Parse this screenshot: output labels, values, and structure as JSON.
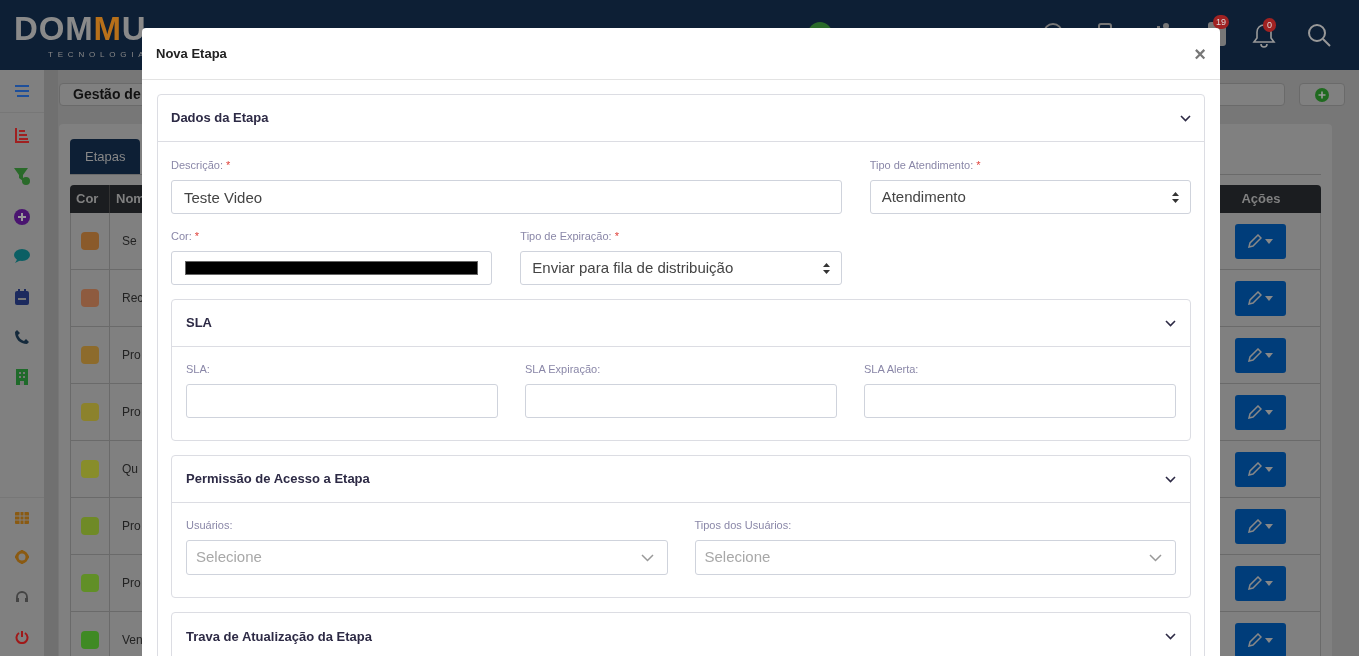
{
  "logo": {
    "prefix": "DOM",
    "accent": "M",
    "suffix": "U",
    "tagline": "TECNOLOGIA"
  },
  "header": {
    "badges": [
      {
        "count": "19"
      },
      {
        "count": "0"
      }
    ]
  },
  "page_title": "Gestão de",
  "tabs": [
    {
      "label": "Etapas",
      "selected": true
    }
  ],
  "table": {
    "columns": [
      "Cor",
      "Nom",
      "Ações"
    ],
    "rows": [
      {
        "color": "#8a5a2a",
        "name": "Se"
      },
      {
        "color": "#8e5b3f",
        "name": "Rec"
      },
      {
        "color": "#8d6b2c",
        "name": "Pro"
      },
      {
        "color": "#8c822c",
        "name": "Pro"
      },
      {
        "color": "#888d2a",
        "name": "Qu"
      },
      {
        "color": "#6f8a27",
        "name": "Pro"
      },
      {
        "color": "#618f27",
        "name": "Pro"
      },
      {
        "color": "#3f8a24",
        "name": "Ven"
      }
    ]
  },
  "modal": {
    "title": "Nova Etapa",
    "close": "×",
    "section": {
      "title": "Dados da Etapa",
      "rows": [
        [
          {
            "kind": "text",
            "label": "Descrição:",
            "required_mark": "*",
            "value": "Teste Video"
          },
          {
            "kind": "select",
            "label": "Tipo de Atendimento:",
            "required_mark": "*",
            "value": "Atendimento"
          }
        ],
        [
          {
            "kind": "color",
            "label": "Cor:",
            "required_mark": "*",
            "color": "#000000"
          },
          {
            "kind": "select",
            "label": "Tipo de Expiração:",
            "required_mark": "*",
            "value": "Enviar para fila de distribuição"
          }
        ]
      ],
      "subsections": [
        {
          "title": "SLA",
          "fields": [
            {
              "kind": "text",
              "label": "SLA:"
            },
            {
              "kind": "text",
              "label": "SLA Expiração:"
            },
            {
              "kind": "text",
              "label": "SLA Alerta:"
            }
          ]
        },
        {
          "title": "Permissão de Acesso a Etapa",
          "fields": [
            {
              "kind": "multiselect",
              "label": "Usuários:",
              "placeholder": "Selecione"
            },
            {
              "kind": "multiselect",
              "label": "Tipos dos Usuários:",
              "placeholder": "Selecione"
            }
          ]
        },
        {
          "title": "Trava de Atualização da Etapa"
        }
      ]
    }
  }
}
